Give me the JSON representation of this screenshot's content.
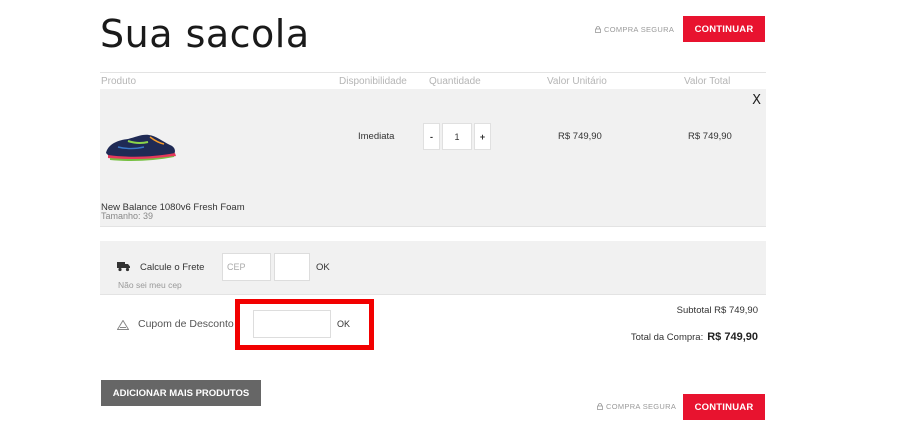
{
  "page": {
    "title": "Sua sacola"
  },
  "header": {
    "secure_label": "COMPRA SEGURA",
    "continue_label": "CONTINUAR"
  },
  "table": {
    "columns": [
      "Produto",
      "Disponibilidade",
      "Quantidade",
      "Valor Unitário",
      "Valor Total"
    ]
  },
  "cart_item": {
    "remove_label": "X",
    "name": "New Balance 1080v6 Fresh Foam",
    "size": "Tamanho: 39",
    "availability": "Imediata",
    "qty_minus": "-",
    "quantity": "1",
    "qty_plus": "+",
    "unit_price": "R$ 749,90",
    "total_price": "R$ 749,90"
  },
  "shipping": {
    "label": "Calcule o Frete",
    "cep_placeholder": "CEP",
    "ok_label": "OK",
    "unknown_cep": "Não sei meu cep"
  },
  "coupon": {
    "label": "Cupom de Desconto",
    "ok_label": "OK"
  },
  "summary": {
    "subtotal_text": "Subtotal R$ 749,90",
    "total_label": "Total da Compra:",
    "total_value": "R$ 749,90"
  },
  "footer": {
    "add_more_label": "ADICIONAR MAIS PRODUTOS",
    "secure_label": "COMPRA SEGURA",
    "continue_label": "CONTINUAR"
  },
  "colors": {
    "accent": "#e8132f",
    "highlight": "#f20000",
    "panel": "#f1f1f1"
  }
}
